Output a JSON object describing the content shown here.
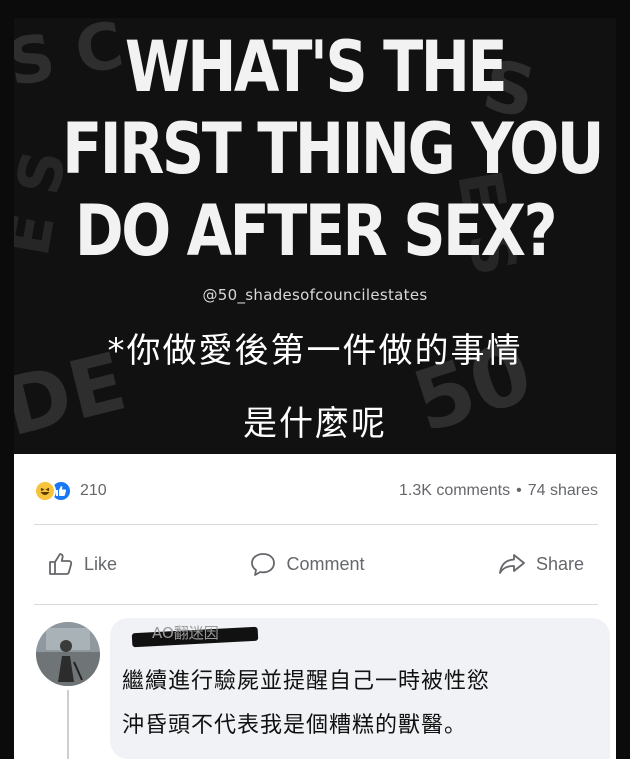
{
  "meme": {
    "headline_lines": [
      "WHAT'S THE",
      "FIRST THING YOU",
      "DO AFTER SEX?"
    ],
    "handle": "@50_shadesofcouncilestates",
    "cn_lines": [
      "*你做愛後第一件做的事情",
      "是什麼呢"
    ],
    "bg_words": [
      "S C",
      "S",
      "DE",
      "50",
      "E S",
      "E S"
    ]
  },
  "post": {
    "reaction_count": "210",
    "comments_count": "1.3K comments",
    "separator": "•",
    "shares_count": "74 shares",
    "actions": {
      "like_label": "Like",
      "comment_label": "Comment",
      "share_label": "Share"
    }
  },
  "comment": {
    "watermark": "AO翻迷因",
    "text_lines": [
      "繼續進行驗屍並提醒自己一時被性慾",
      "沖昏頭不代表我是個糟糕的獸醫。"
    ]
  },
  "colors": {
    "facebook_blue": "#1877f2",
    "haha_yellow": "#f7c33b",
    "meta_gray": "#65676b",
    "bubble_bg": "#f0f2f5"
  }
}
